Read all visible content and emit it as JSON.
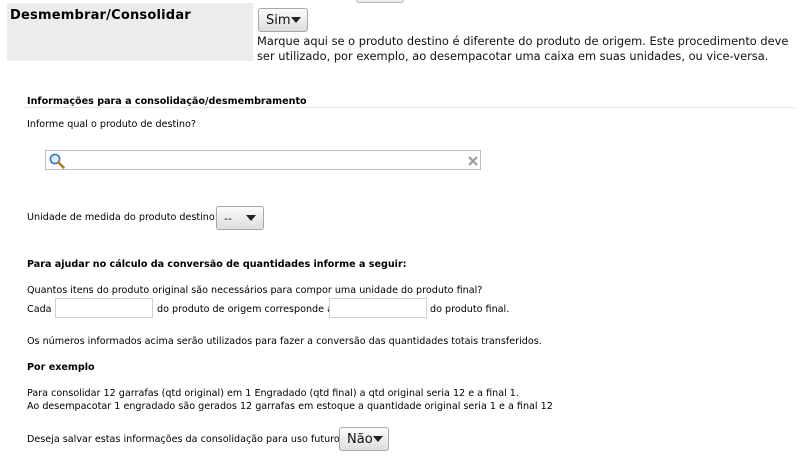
{
  "field": {
    "title": "Desmembrar/Consolidar",
    "select_value": "Sim",
    "help": "Marque aqui se o produto destino é diferente do produto de origem. Este procedimento deve ser utilizado, por exemplo, ao desempacotar uma caixa em suas unidades, ou vice-versa."
  },
  "consolidation": {
    "heading": "Informações para a consolidação/desmembramento",
    "dest_question": "Informe qual o produto de destino?",
    "search_value": "",
    "unit_label": "Unidade de medida do produto destino:",
    "unit_value": "--"
  },
  "conversion": {
    "heading": "Para ajudar no cálculo da conversão de quantidades informe a seguir:",
    "question": "Quantos itens do produto original são necessários para compor uma unidade do produto final?",
    "cada": "Cada",
    "middle": "do produto de origem corresponde a",
    "end": "do produto final.",
    "origin_value": "",
    "final_value": "",
    "note": "Os números informados acima serão utilizados para fazer a conversão das quantidades totais transferidos."
  },
  "example": {
    "heading": "Por exemplo",
    "line1": "Para consolidar 12 garrafas (qtd original) em 1 Engradado (qtd final) a qtd original seria 12 e a final 1.",
    "line2": "Ao desempacotar 1 engradado são gerados 12 garrafas em estoque a quantidade original seria 1 e a final 12"
  },
  "save": {
    "question": "Deseja salvar estas informações da consolidação para uso futuro?",
    "select_value": "Não"
  }
}
